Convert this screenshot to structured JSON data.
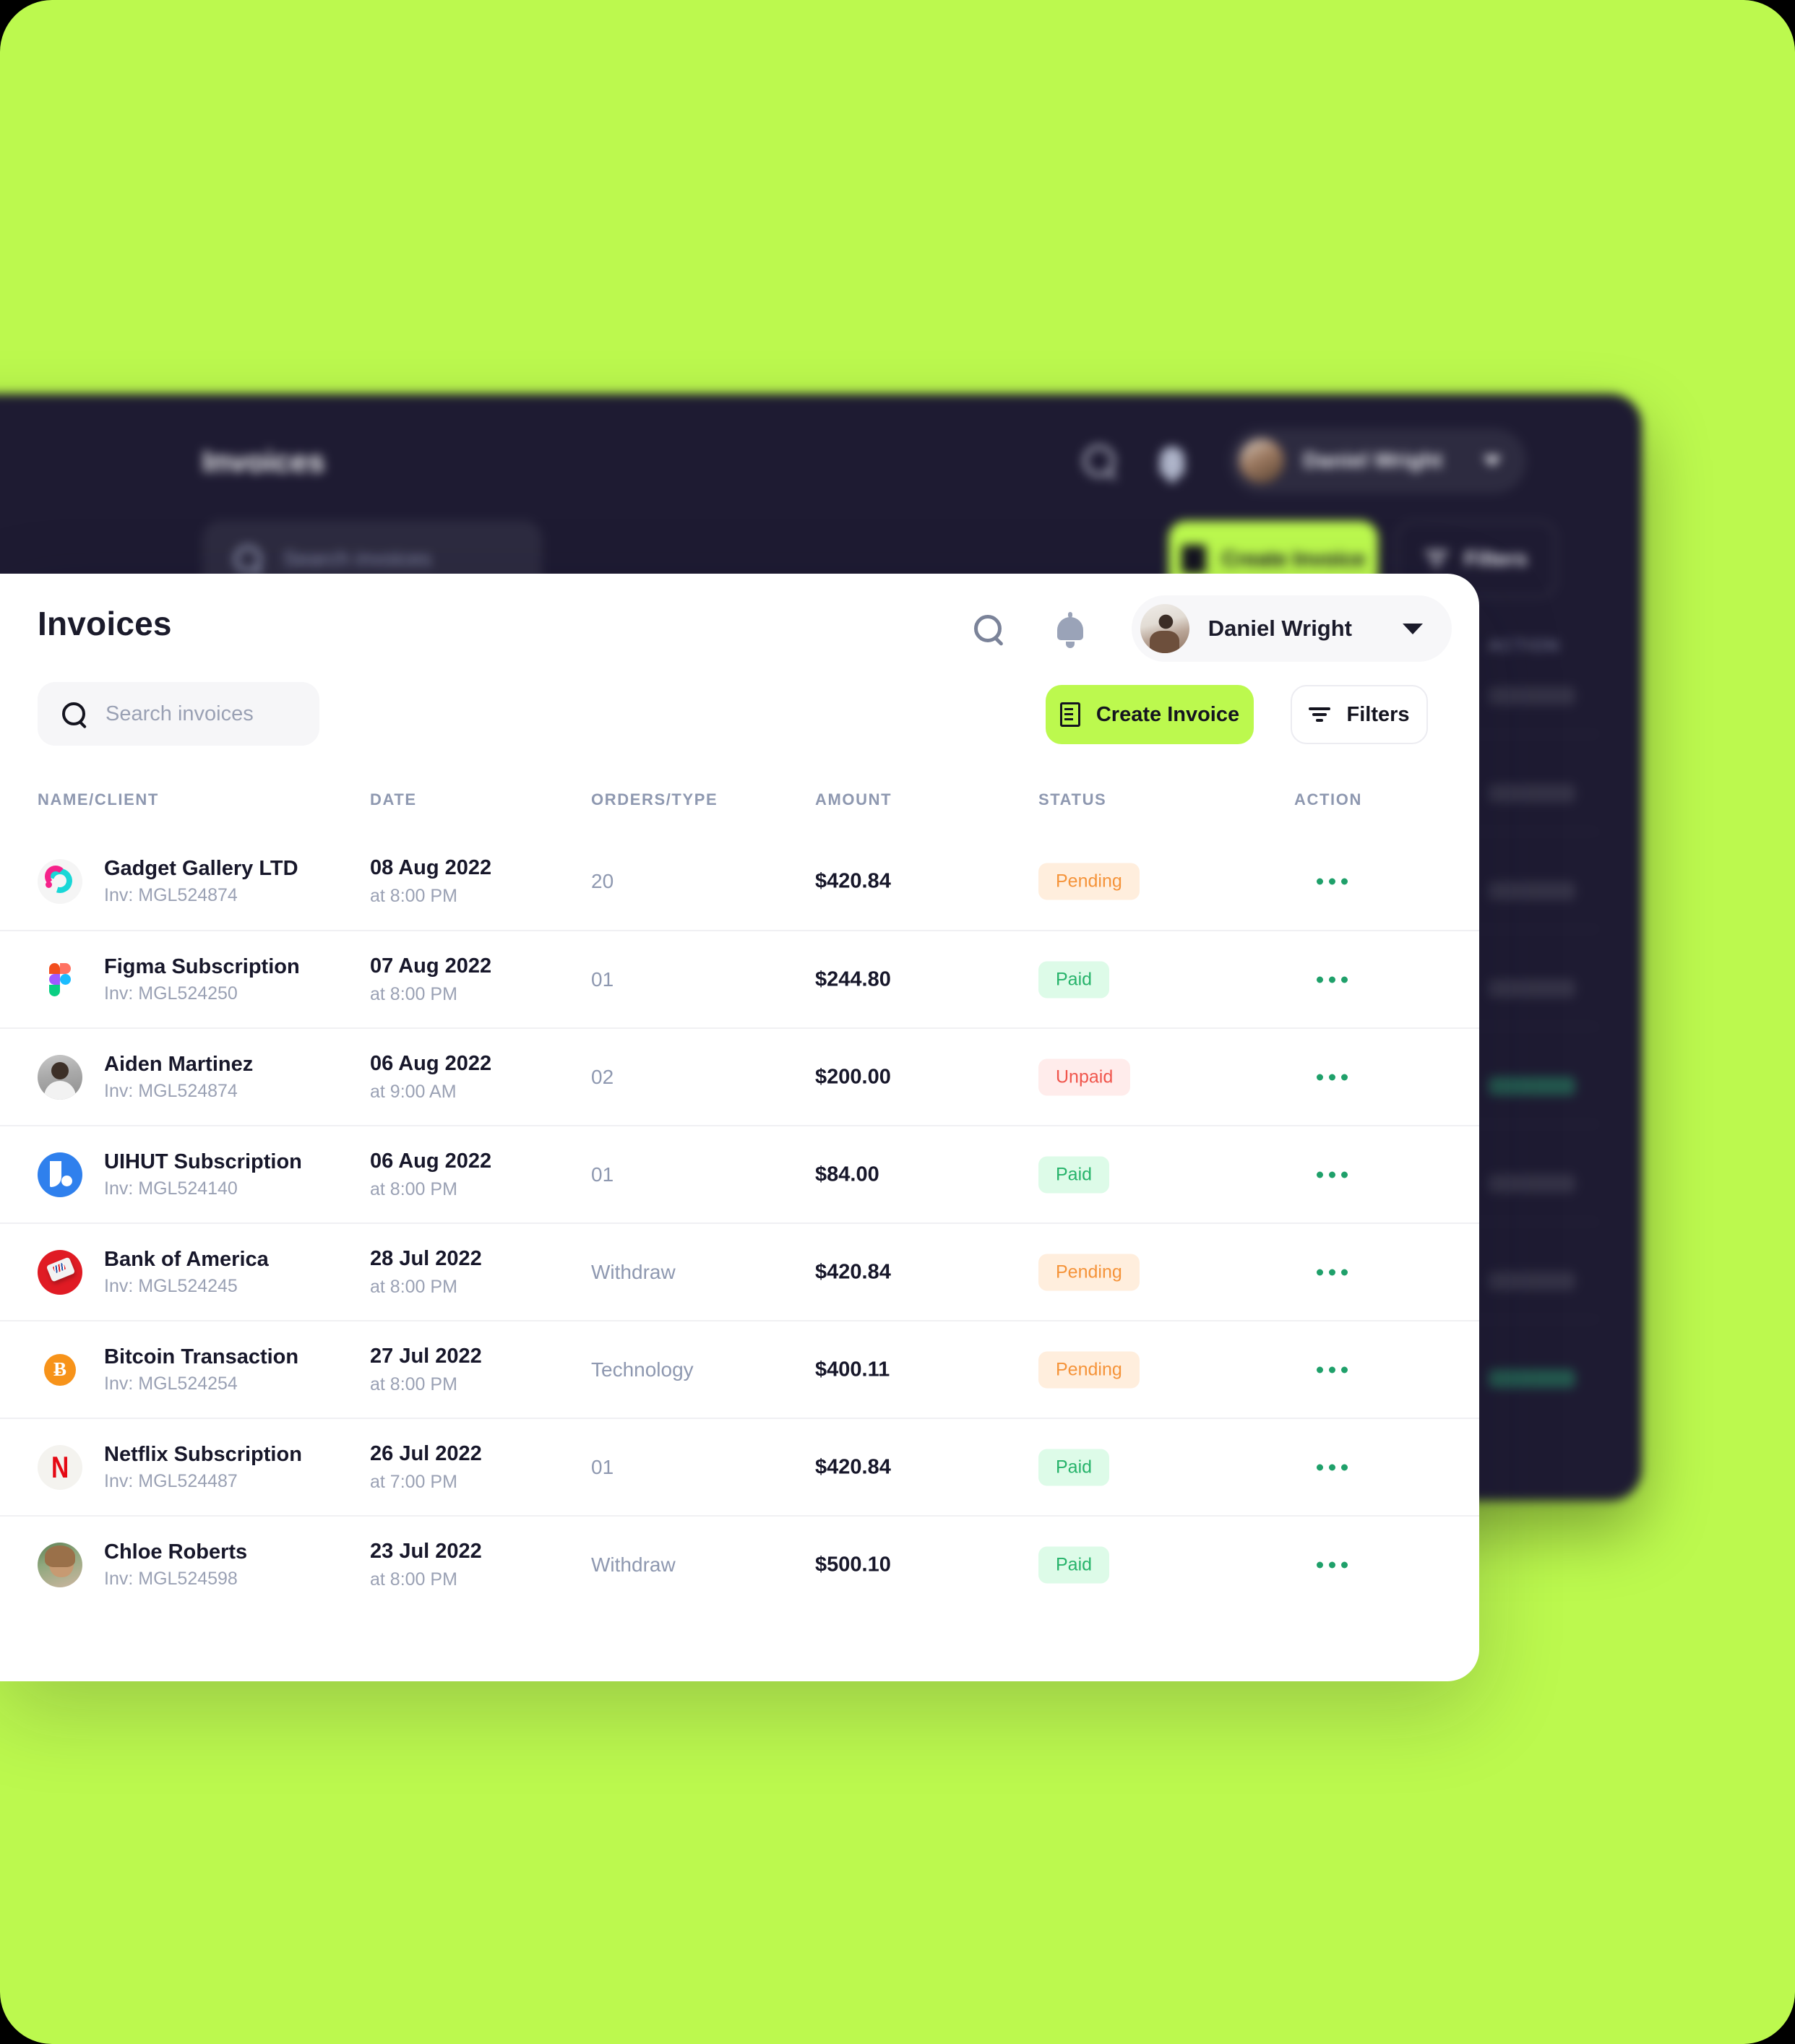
{
  "brand": {
    "accent_green": "#bcf94e",
    "dark_panel": "#1e1b32",
    "card_bg": "#ffffff"
  },
  "header": {
    "title": "Invoices",
    "search_icon": "search-icon",
    "bell_icon": "bell-icon",
    "user": {
      "name": "Daniel Wright",
      "avatar": "user-avatar",
      "caret": "chevron-down-icon"
    }
  },
  "toolbar": {
    "search_placeholder": "Search invoices",
    "search_value": "",
    "create_label": "Create Invoice",
    "create_icon": "receipt-icon",
    "filters_label": "Filters",
    "filters_icon": "filter-icon"
  },
  "table": {
    "columns": [
      "NAME/CLIENT",
      "DATE",
      "ORDERS/TYPE",
      "AMOUNT",
      "STATUS",
      "ACTION"
    ],
    "rows": [
      {
        "logo": "gadget-gallery-logo",
        "name": "Gadget Gallery LTD",
        "invoice": "Inv: MGL524874",
        "date": "08 Aug 2022",
        "time": "at 8:00 PM",
        "type": "20",
        "amount": "$420.84",
        "status": "Pending",
        "status_kind": "pending"
      },
      {
        "logo": "figma-logo",
        "name": "Figma Subscription",
        "invoice": "Inv: MGL524250",
        "date": "07 Aug 2022",
        "time": "at 8:00 PM",
        "type": "01",
        "amount": "$244.80",
        "status": "Paid",
        "status_kind": "paid"
      },
      {
        "logo": "aiden-avatar",
        "name": "Aiden Martinez",
        "invoice": "Inv: MGL524874",
        "date": "06 Aug 2022",
        "time": "at 9:00 AM",
        "type": "02",
        "amount": "$200.00",
        "status": "Unpaid",
        "status_kind": "unpaid"
      },
      {
        "logo": "uihut-logo",
        "name": "UIHUT Subscription",
        "invoice": "Inv: MGL524140",
        "date": "06 Aug 2022",
        "time": "at 8:00 PM",
        "type": "01",
        "amount": "$84.00",
        "status": "Paid",
        "status_kind": "paid"
      },
      {
        "logo": "bank-of-america-logo",
        "name": "Bank of America",
        "invoice": "Inv: MGL524245",
        "date": "28 Jul 2022",
        "time": "at 8:00 PM",
        "type": "Withdraw",
        "amount": "$420.84",
        "status": "Pending",
        "status_kind": "pending"
      },
      {
        "logo": "bitcoin-logo",
        "name": "Bitcoin Transaction",
        "invoice": "Inv: MGL524254",
        "date": "27 Jul 2022",
        "time": "at 8:00 PM",
        "type": "Technology",
        "amount": "$400.11",
        "status": "Pending",
        "status_kind": "pending"
      },
      {
        "logo": "netflix-logo",
        "name": "Netflix Subscription",
        "invoice": "Inv: MGL524487",
        "date": "26 Jul 2022",
        "time": "at 7:00 PM",
        "type": "01",
        "amount": "$420.84",
        "status": "Paid",
        "status_kind": "paid"
      },
      {
        "logo": "chloe-avatar",
        "name": "Chloe Roberts",
        "invoice": "Inv: MGL524598",
        "date": "23 Jul 2022",
        "time": "at 8:00 PM",
        "type": "Withdraw",
        "amount": "$500.10",
        "status": "Paid",
        "status_kind": "paid"
      }
    ]
  },
  "background_panel": {
    "title": "Invoices",
    "search_placeholder": "Search invoices",
    "create_label": "Create Invoice",
    "filters_label": "Filters",
    "user_name": "Daniel Wright",
    "action_column": "ACTION"
  }
}
